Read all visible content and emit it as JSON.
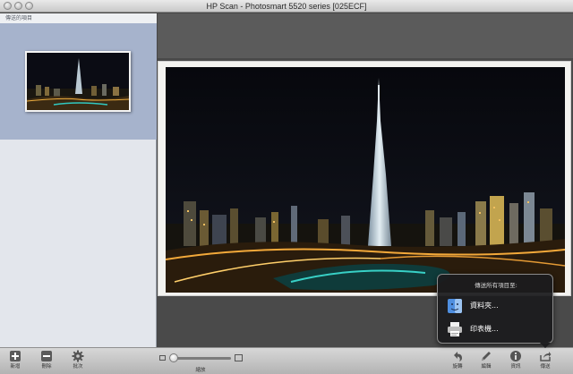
{
  "window": {
    "title": "HP Scan - Photosmart 5520 series [025ECF]"
  },
  "sidebar": {
    "header": "傳送的項目"
  },
  "toolbar": {
    "left_buttons": [
      {
        "label": "新增",
        "icon": "plus-icon"
      },
      {
        "label": "刪除",
        "icon": "minus-icon"
      },
      {
        "label": "批次",
        "icon": "gear-icon"
      }
    ],
    "zoom_label": "縮放",
    "right_buttons": [
      {
        "label": "旋轉",
        "icon": "rotate-icon"
      },
      {
        "label": "編輯",
        "icon": "pencil-icon"
      },
      {
        "label": "資訊",
        "icon": "info-icon"
      },
      {
        "label": "傳送",
        "icon": "share-icon"
      }
    ]
  },
  "send_popup": {
    "title": "傳送所有項目至:",
    "items": [
      {
        "label": "資料夾...",
        "icon": "finder-icon"
      },
      {
        "label": "印表機...",
        "icon": "printer-icon"
      }
    ]
  },
  "colors": {
    "sidebar_selected": "#a6b3cc",
    "popup_bg": "#1c1c1e",
    "night_sky": "#0a0b12"
  }
}
